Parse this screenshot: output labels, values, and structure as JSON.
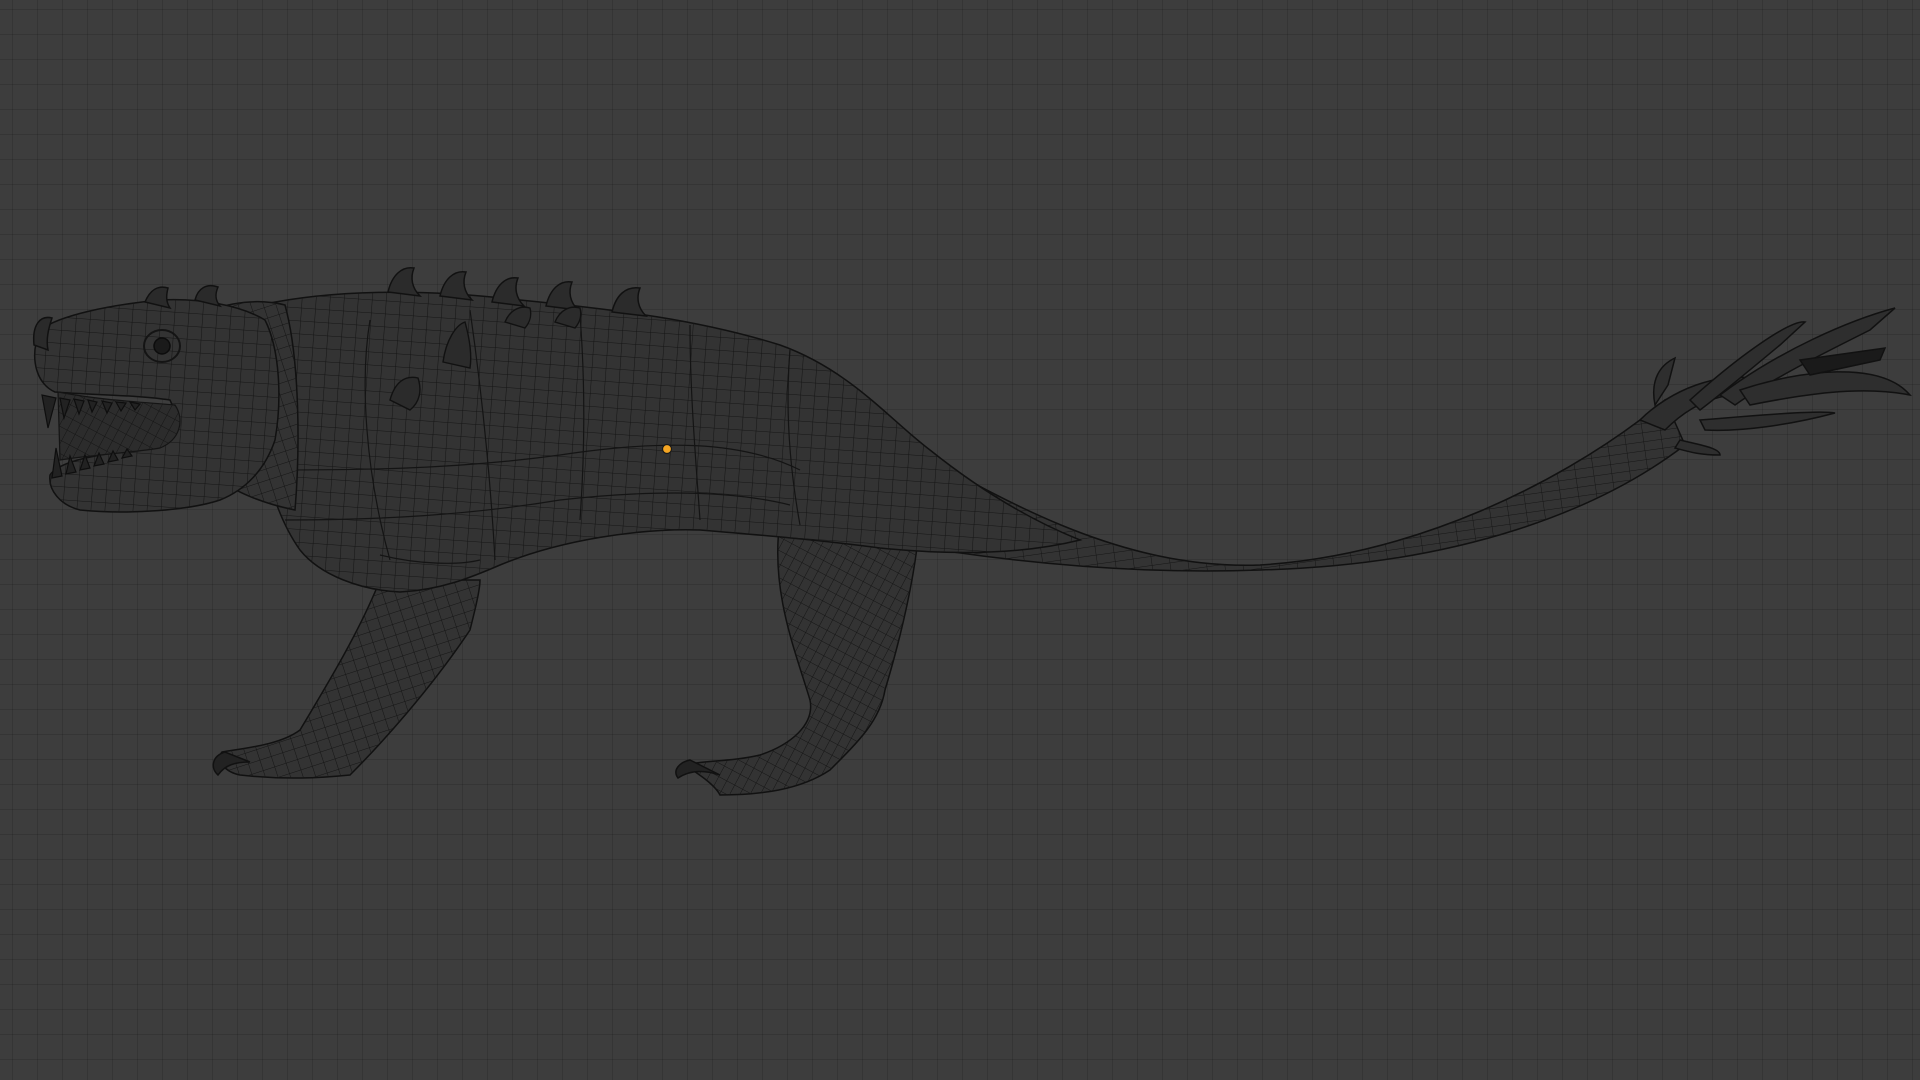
{
  "viewport": {
    "background_color": "#3d3d3d",
    "grid_color": "#343434",
    "mesh_fill_color": "#333333",
    "wire_color": "#141414",
    "origin_color": "#f5a623",
    "view_mode": "wireframe"
  },
  "object": {
    "kind": "creature-mesh",
    "selected": false
  }
}
